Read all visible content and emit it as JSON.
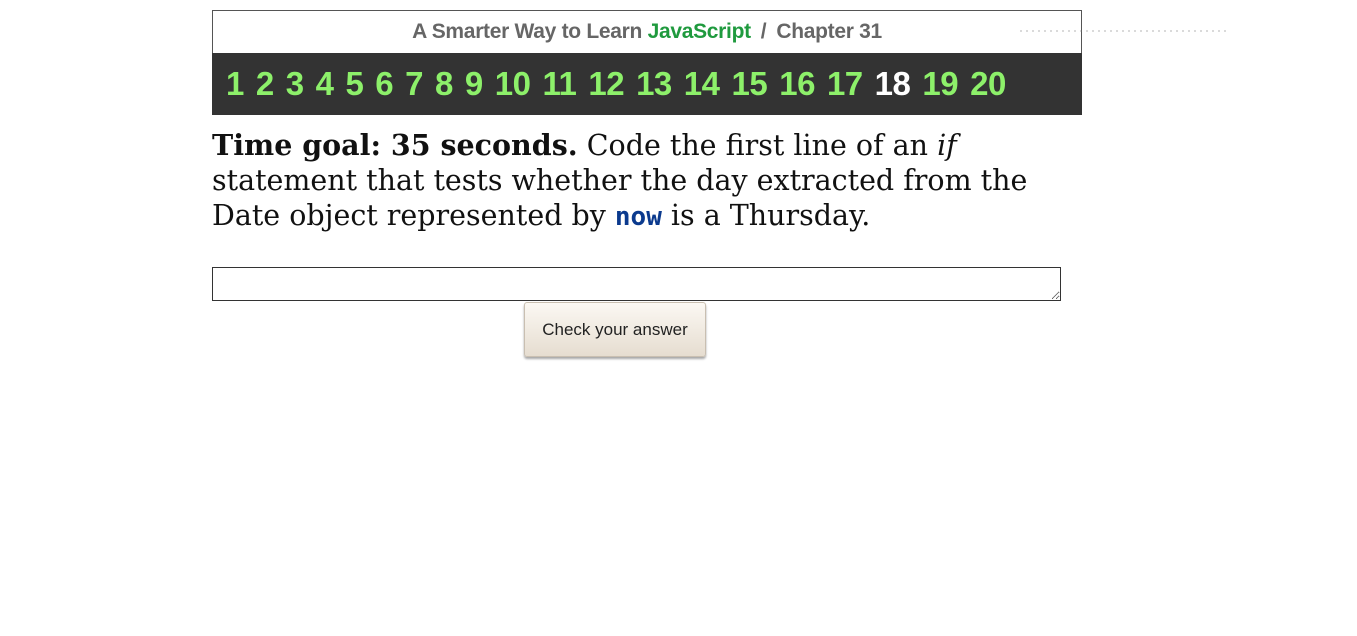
{
  "header": {
    "title_prefix": "A Smarter Way to Learn ",
    "title_brand": "JavaScript",
    "separator": "/",
    "chapter": "Chapter 31"
  },
  "exercises": {
    "numbers": [
      "1",
      "2",
      "3",
      "4",
      "5",
      "6",
      "7",
      "8",
      "9",
      "10",
      "11",
      "12",
      "13",
      "14",
      "15",
      "16",
      "17",
      "18",
      "19",
      "20"
    ],
    "current": "18"
  },
  "question": {
    "goal": "Time goal: 35 seconds.",
    "text_1": " Code the first line of an ",
    "keyword": "if",
    "text_2": " statement that tests whether the day extracted from the Date object represented by ",
    "code": "now",
    "text_3": " is a Thursday."
  },
  "answer": {
    "value": "",
    "placeholder": ""
  },
  "check_button": {
    "label": "Check your answer"
  },
  "colors": {
    "brand_green": "#1f9a3e",
    "nav_green": "#8df06a",
    "nav_current": "#ffffff",
    "nav_bg": "#333333",
    "code_blue": "#0b3a8e"
  }
}
